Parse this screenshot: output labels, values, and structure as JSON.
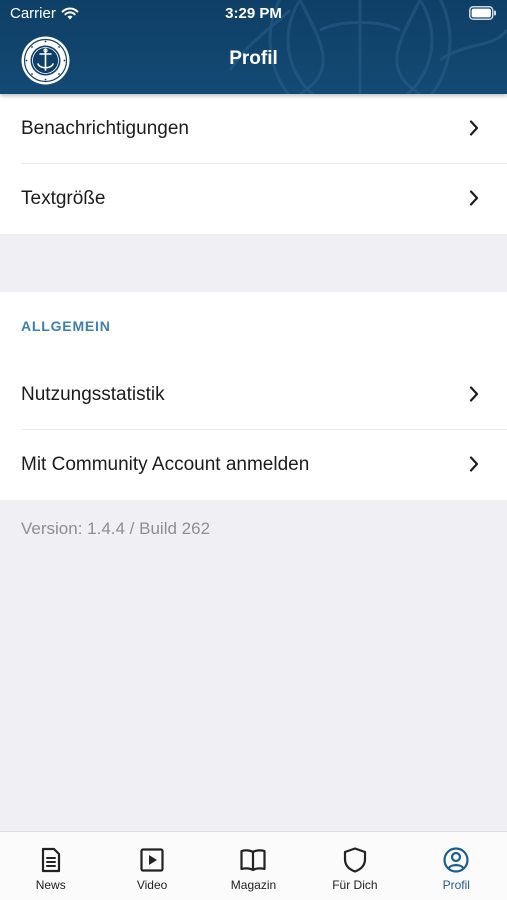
{
  "status_bar": {
    "carrier": "Carrier",
    "time": "3:29 PM"
  },
  "header": {
    "title": "Profil"
  },
  "settings_group_1": {
    "items": [
      {
        "label": "Benachrichtigungen"
      },
      {
        "label": "Textgröße"
      }
    ]
  },
  "settings_group_2": {
    "section_title": "ALLGEMEIN",
    "items": [
      {
        "label": "Nutzungsstatistik"
      },
      {
        "label": "Mit Community Account anmelden"
      }
    ]
  },
  "version_text": "Version: 1.4.4 / Build 262",
  "tab_bar": {
    "active": "Profil",
    "tabs": [
      {
        "label": "News",
        "icon": "news-icon"
      },
      {
        "label": "Video",
        "icon": "video-icon"
      },
      {
        "label": "Magazin",
        "icon": "magazine-icon"
      },
      {
        "label": "Für Dich",
        "icon": "shield-icon"
      },
      {
        "label": "Profil",
        "icon": "profile-icon"
      }
    ]
  },
  "colors": {
    "header_bg": "#134a74",
    "accent": "#1f5d8c",
    "section_title": "#3e7fb3",
    "page_bg": "#efeff4",
    "version_text": "#8e8e93"
  }
}
